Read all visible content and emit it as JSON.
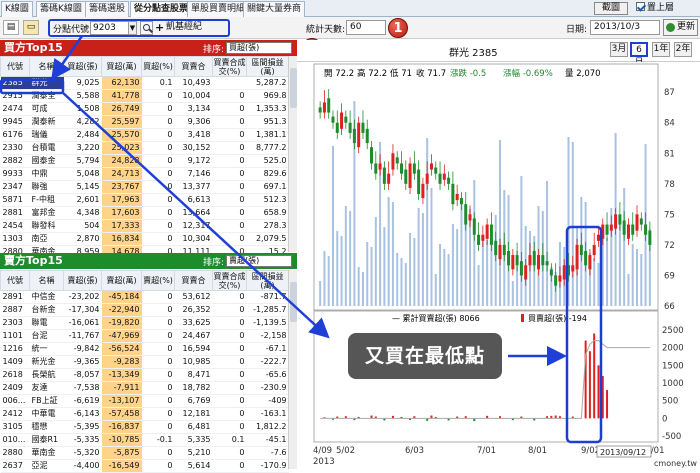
{
  "tabs": [
    "K線圖",
    "籌碼K線圖",
    "籌碼選股",
    "從分點查股票",
    "單股買賣明細",
    "關鍵大量券商"
  ],
  "active_tab": 3,
  "top": {
    "screenshot_label": "截圖",
    "always_on_top_label": "置上層"
  },
  "toolbar": {
    "code_label": "分點代號:",
    "code_value": "9203",
    "plus": "+",
    "name_link": "凱基經紀",
    "days_label": "統計天數:",
    "days_value": "60",
    "date_label": "日期:",
    "date_value": "2013/10/3",
    "refresh_label": "更新",
    "badge1": "1",
    "badge2": "2"
  },
  "buy_panel": {
    "title": "買方Top15",
    "sort_label": "排序:",
    "sort_value": "買超(張)"
  },
  "sell_panel": {
    "title": "賣方Top15",
    "sort_label": "排序:",
    "sort_value": "賣超(張)"
  },
  "buy_headers": [
    "代號",
    "名稱",
    "買超(張)",
    "買超(萬)",
    "買超(%)",
    "買賣合",
    "買賣合成交(%)",
    "區間損益(萬)"
  ],
  "sell_headers": [
    "代號",
    "名稱",
    "賣超(張)",
    "賣超(萬)",
    "賣超(%)",
    "買賣合",
    "買賣合成交(%)",
    "區間損益(萬)"
  ],
  "buy_rows": [
    [
      "2385",
      "群光",
      "9,025",
      "62,130",
      "0.1",
      "10,493",
      "",
      "5,287.2"
    ],
    [
      "2915",
      "潤泰全",
      "5,588",
      "41,778",
      "0",
      "10,004",
      "0",
      "969.8"
    ],
    [
      "2474",
      "可成",
      "1,508",
      "26,749",
      "0",
      "3,134",
      "0",
      "1,353.3"
    ],
    [
      "9945",
      "潤泰新",
      "4,282",
      "25,597",
      "0",
      "9,306",
      "0",
      "951.3"
    ],
    [
      "6176",
      "瑞儀",
      "2,484",
      "25,570",
      "0",
      "3,418",
      "0",
      "1,381.1"
    ],
    [
      "2330",
      "台積電",
      "3,220",
      "25,023",
      "0",
      "30,152",
      "0",
      "8,777.2"
    ],
    [
      "2882",
      "國泰金",
      "5,794",
      "24,828",
      "0",
      "9,172",
      "0",
      "525.0"
    ],
    [
      "9933",
      "中鼎",
      "5,048",
      "24,713",
      "0",
      "7,146",
      "0",
      "829.6"
    ],
    [
      "2347",
      "聯強",
      "5,145",
      "23,767",
      "0",
      "13,377",
      "0",
      "697.1"
    ],
    [
      "5871",
      "F-中租",
      "2,601",
      "17,963",
      "0",
      "6,613",
      "0",
      "512.3"
    ],
    [
      "2881",
      "富邦金",
      "4,348",
      "17,603",
      "0",
      "13,664",
      "0",
      "658.9"
    ],
    [
      "2454",
      "聯發科",
      "504",
      "17,333",
      "0",
      "12,317",
      "0",
      "278.3"
    ],
    [
      "1303",
      "南亞",
      "2,870",
      "16,834",
      "0",
      "10,304",
      "0",
      "2,079.5"
    ],
    [
      "2880",
      "華南金",
      "8,959",
      "14,678",
      "0",
      "11,111",
      "0",
      "15.2"
    ]
  ],
  "sell_rows": [
    [
      "2891",
      "中信金",
      "-23,202",
      "-45,184",
      "0",
      "53,612",
      "0",
      "-871.7"
    ],
    [
      "2887",
      "台新金",
      "-17,304",
      "-22,940",
      "0",
      "26,352",
      "0",
      "-1,285.7"
    ],
    [
      "2303",
      "聯電",
      "-16,061",
      "-19,820",
      "0",
      "33,625",
      "0",
      "-1,139.5"
    ],
    [
      "1101",
      "台泥",
      "-11,767",
      "-47,969",
      "0",
      "24,467",
      "0",
      "-2,158"
    ],
    [
      "1216",
      "統一",
      "-9,842",
      "-56,524",
      "0",
      "16,594",
      "0",
      "-67.1"
    ],
    [
      "1409",
      "新光金",
      "-9,365",
      "-9,283",
      "0",
      "10,985",
      "0",
      "-222.7"
    ],
    [
      "2618",
      "長榮航",
      "-8,057",
      "-13,349",
      "0",
      "8,471",
      "0",
      "-65.6"
    ],
    [
      "2409",
      "友達",
      "-7,538",
      "-7,911",
      "0",
      "18,782",
      "0",
      "-230.9"
    ],
    [
      "006...",
      "FB上証",
      "-6,619",
      "-13,107",
      "0",
      "6,769",
      "0",
      "-409"
    ],
    [
      "2412",
      "中華電",
      "-6,143",
      "-57,458",
      "0",
      "12,181",
      "0",
      "-163.1"
    ],
    [
      "3105",
      "穩懋",
      "-5,395",
      "-16,837",
      "0",
      "6,481",
      "0",
      "1,812.2"
    ],
    [
      "010...",
      "國泰R1",
      "-5,335",
      "-10,785",
      "-0.1",
      "5,335",
      "0.1",
      "-45.1"
    ],
    [
      "2880",
      "華南金",
      "-5,320",
      "-5,875",
      "0",
      "5,210",
      "0",
      "-7.6"
    ],
    [
      "2637",
      "亞泥",
      "-4,400",
      "-16,549",
      "0",
      "5,614",
      "0",
      "-170.9"
    ]
  ],
  "chart": {
    "period_buttons": [
      "3月",
      "6月",
      "1年",
      "2年"
    ],
    "active_period": "6月",
    "title": "群光 2385",
    "info": {
      "open_label": "開",
      "open": "72.2",
      "high_label": "高",
      "high": "72.2",
      "low_label": "低",
      "low": "71",
      "close_label": "收",
      "close": "71.7",
      "chg_label": "漲跌",
      "chg": "-0.5",
      "pct_label": "漲幅",
      "pct": "-0.69%",
      "vol_label": "量",
      "vol": "2,070"
    },
    "price_ticks": [
      "87",
      "84",
      "81",
      "78",
      "75",
      "72",
      "69",
      "66"
    ],
    "legend_line": "— 累計買賣超(張) 8066",
    "legend_bar": "買賣超(張) -194",
    "inst_ticks": [
      "2500",
      "2000",
      "1500",
      "1000",
      "500",
      "0",
      "-500"
    ],
    "date_labels": [
      "4/09",
      "5/02",
      "6/03",
      "7/01",
      "8/01",
      "9/02",
      "10/01"
    ],
    "year_label": "2013",
    "cursor_date": "2013/09/12",
    "watermark": "cmoney.tw",
    "callout": "又買在最低點"
  },
  "chart_data": {
    "type": "candlestick",
    "title": "群光 2385",
    "ylim": [
      66,
      88
    ],
    "x_range": [
      "2013-04-09",
      "2013-10-03"
    ],
    "last": {
      "open": 72.2,
      "high": 72.2,
      "low": 71,
      "close": 71.7
    },
    "price_path": [
      85,
      86,
      85,
      84,
      83,
      85,
      84,
      83,
      82,
      84,
      83,
      82,
      80,
      79,
      80,
      78,
      79,
      81,
      80,
      79,
      78,
      80,
      79,
      77,
      78,
      79,
      80,
      79,
      78,
      79,
      78,
      76,
      77,
      76,
      74,
      75,
      73,
      72,
      73,
      74,
      72,
      71,
      72,
      71,
      70,
      71,
      70,
      69,
      70,
      71,
      70,
      71,
      70,
      70,
      69,
      68,
      69,
      70,
      69,
      70,
      72,
      71,
      70,
      71,
      72,
      73,
      74,
      73,
      74,
      75,
      74,
      73,
      74,
      73,
      75,
      74,
      73,
      72
    ],
    "inst_ylim": [
      -500,
      2500
    ],
    "inst_bars": [
      0,
      30,
      0,
      -40,
      50,
      0,
      60,
      0,
      -50,
      40,
      0,
      0,
      80,
      50,
      0,
      -60,
      0,
      70,
      0,
      40,
      0,
      -50,
      60,
      0,
      0,
      -70,
      80,
      40,
      0,
      0,
      -60,
      0,
      50,
      0,
      60,
      0,
      -80,
      0,
      0,
      70,
      0,
      0,
      60,
      0,
      0,
      -50,
      0,
      50,
      0,
      0,
      -60,
      0,
      0,
      60,
      70,
      80,
      60,
      0,
      0,
      50,
      0,
      0,
      2200,
      1900,
      2400,
      1500,
      1200,
      800,
      0,
      0,
      0,
      0,
      0,
      0,
      0,
      0,
      0,
      0
    ],
    "cum_line": [
      0,
      0,
      0,
      0,
      0,
      0,
      0,
      0,
      0,
      0,
      0,
      0,
      0,
      0,
      0,
      0,
      0,
      0,
      0,
      0,
      0,
      0,
      0,
      0,
      0,
      0,
      0,
      0,
      0,
      0,
      0,
      0,
      0,
      0,
      0,
      0,
      0,
      0,
      0,
      0,
      0,
      0,
      0,
      0,
      0,
      0,
      0,
      0,
      0,
      0,
      0,
      0,
      0,
      0,
      0,
      0,
      0,
      0,
      0,
      0,
      0,
      0,
      1800,
      2100,
      2200,
      2200,
      2100,
      2000,
      2000,
      2000,
      2000,
      2000,
      2000,
      2000,
      2000,
      2000,
      2000,
      2000
    ]
  }
}
